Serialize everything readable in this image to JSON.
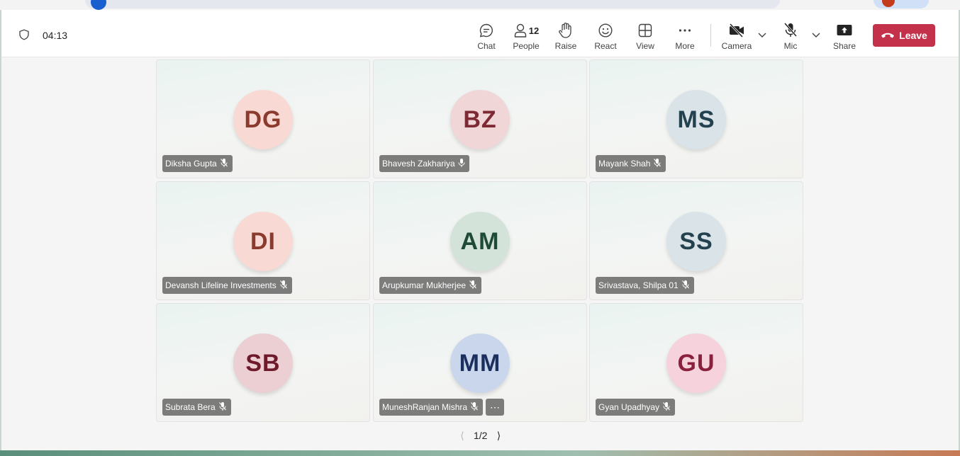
{
  "meeting": {
    "timer": "04:13"
  },
  "toolbar": {
    "chat": "Chat",
    "people": "People",
    "people_count": "12",
    "raise": "Raise",
    "react": "React",
    "view": "View",
    "more": "More",
    "camera": "Camera",
    "mic": "Mic",
    "share": "Share",
    "leave": "Leave"
  },
  "participants": [
    {
      "initials": "DG",
      "name": "Diksha Gupta",
      "mic": "muted",
      "avatar_bg": "#f9d9d3",
      "avatar_fg": "#8a3b2d"
    },
    {
      "initials": "BZ",
      "name": "Bhavesh Zakhariya",
      "mic": "on",
      "avatar_bg": "#f1d6d8",
      "avatar_fg": "#7d2a35"
    },
    {
      "initials": "MS",
      "name": "Mayank Shah",
      "mic": "muted",
      "avatar_bg": "#d9e3e8",
      "avatar_fg": "#23414f"
    },
    {
      "initials": "DI",
      "name": "Devansh Lifeline Investments",
      "mic": "muted",
      "avatar_bg": "#f9d9d3",
      "avatar_fg": "#8a3b2d"
    },
    {
      "initials": "AM",
      "name": "Arupkumar Mukherjee",
      "mic": "muted",
      "avatar_bg": "#d3e3da",
      "avatar_fg": "#1f4a35"
    },
    {
      "initials": "SS",
      "name": "Srivastava, Shilpa 01",
      "mic": "muted",
      "avatar_bg": "#d9e3e8",
      "avatar_fg": "#23414f"
    },
    {
      "initials": "SB",
      "name": "Subrata Bera",
      "mic": "muted",
      "avatar_bg": "#ebcfd3",
      "avatar_fg": "#6e1a2a"
    },
    {
      "initials": "MM",
      "name": "MuneshRanjan Mishra",
      "mic": "muted",
      "avatar_bg": "#c9d6ec",
      "avatar_fg": "#1b2f5e"
    },
    {
      "initials": "GU",
      "name": "Gyan Upadhyay",
      "mic": "muted",
      "avatar_bg": "#f6d2dc",
      "avatar_fg": "#8a1f3e"
    }
  ],
  "pagination": {
    "label": "1/2"
  },
  "colors": {
    "leave": "#c4314b",
    "accent": "#5b5fc7"
  }
}
